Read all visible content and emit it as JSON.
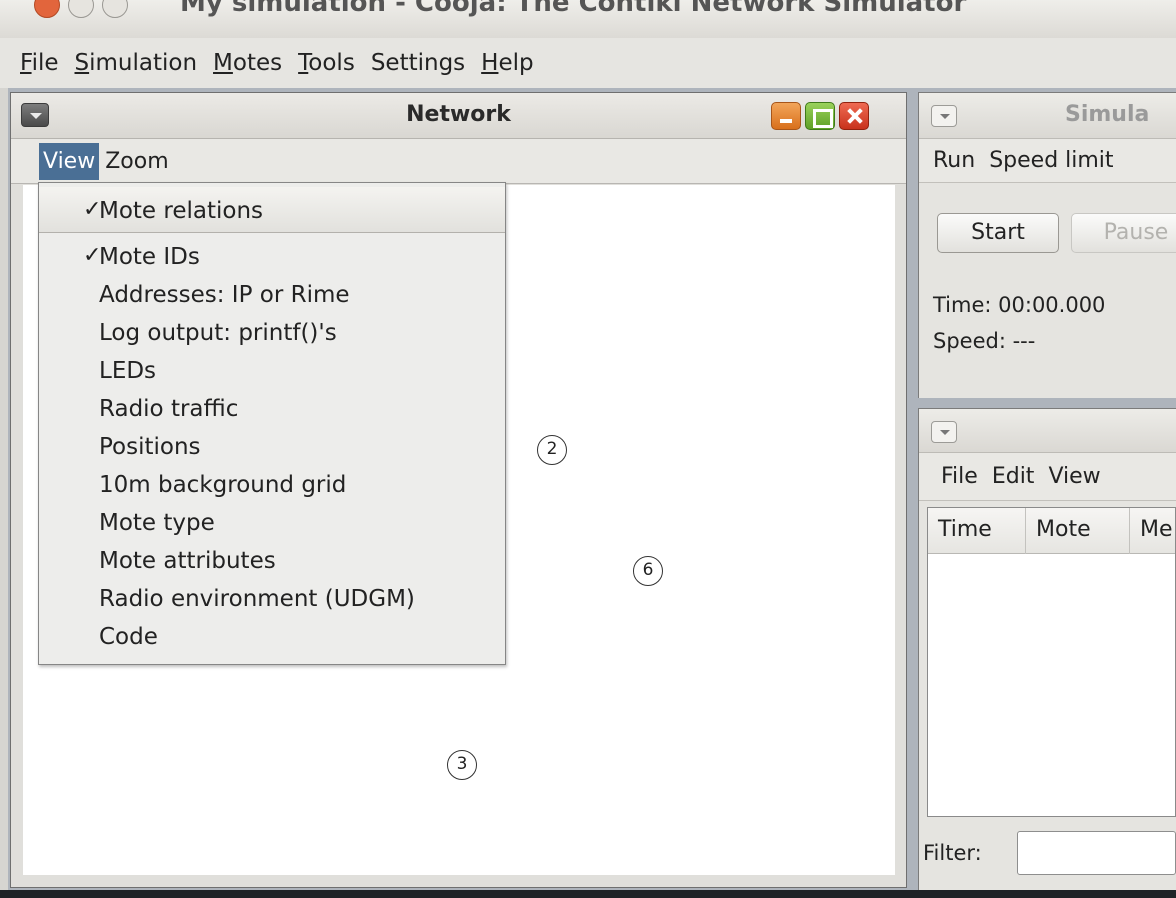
{
  "window": {
    "title": "My simulation - Cooja: The Contiki Network Simulator"
  },
  "menubar": {
    "items": [
      {
        "underline": "F",
        "rest": "ile"
      },
      {
        "underline": "S",
        "rest": "imulation"
      },
      {
        "underline": "M",
        "rest": "otes"
      },
      {
        "underline": "T",
        "rest": "ools"
      },
      {
        "underline": "",
        "rest": "Settings"
      },
      {
        "underline": "H",
        "rest": "elp"
      }
    ]
  },
  "network": {
    "title": "Network",
    "menus": [
      "View",
      "Zoom"
    ],
    "motes": [
      "2",
      "6",
      "3"
    ]
  },
  "view_menu": {
    "items": [
      {
        "label": "Mote relations",
        "checked": true
      },
      {
        "label": "Mote IDs",
        "checked": true
      },
      {
        "label": "Addresses: IP or Rime",
        "checked": false
      },
      {
        "label": "Log output: printf()'s",
        "checked": false
      },
      {
        "label": "LEDs",
        "checked": false
      },
      {
        "label": "Radio traffic",
        "checked": false
      },
      {
        "label": "Positions",
        "checked": false
      },
      {
        "label": "10m background grid",
        "checked": false
      },
      {
        "label": "Mote type",
        "checked": false
      },
      {
        "label": "Mote attributes",
        "checked": false
      },
      {
        "label": "Radio environment (UDGM)",
        "checked": false
      },
      {
        "label": "Code",
        "checked": false
      }
    ]
  },
  "simulation_control": {
    "title": "Simula",
    "menus": [
      "Run",
      "Speed limit"
    ],
    "start_label": "Start",
    "pause_label": "Pause",
    "time_text": "Time: 00:00.000",
    "speed_text": "Speed: ---"
  },
  "mote_output": {
    "menus": [
      "File",
      "Edit",
      "View"
    ],
    "columns": [
      "Time",
      "Mote",
      "Me"
    ],
    "filter_label": "Filter:"
  }
}
